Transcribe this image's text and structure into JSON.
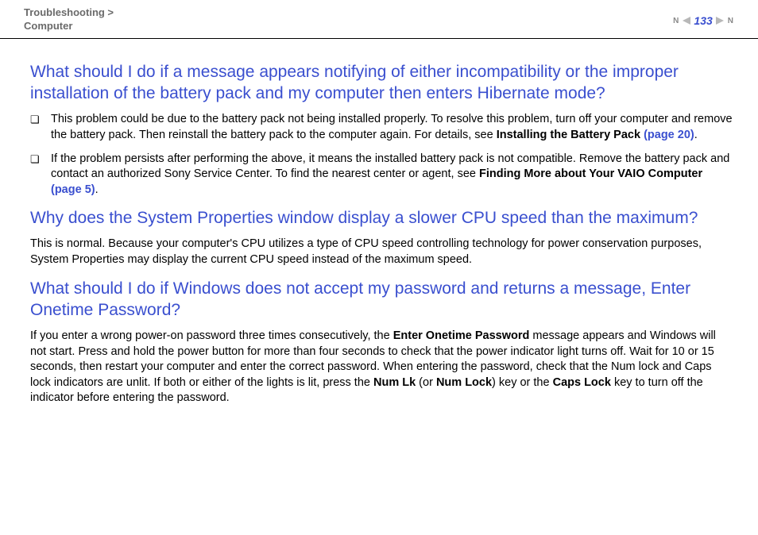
{
  "header": {
    "breadcrumb_line1": "Troubleshooting >",
    "breadcrumb_line2": "Computer",
    "page_number": "133"
  },
  "sections": [
    {
      "heading": "What should I do if a message appears notifying of either incompatibility or the improper installation of the battery pack and my computer then enters Hibernate mode?",
      "bullets": [
        {
          "text_before": "This problem could be due to the battery pack not being installed properly. To resolve this problem, turn off your computer and remove the battery pack. Then reinstall the battery pack to the computer again. For details, see ",
          "bold_ref": "Installing the Battery Pack",
          "page_ref": "(page 20)",
          "text_after": "."
        },
        {
          "text_before": "If the problem persists after performing the above, it means the installed battery pack is not compatible. Remove the battery pack and contact an authorized Sony Service Center. To find the nearest center or agent, see ",
          "bold_ref": "Finding More about Your VAIO Computer",
          "page_ref": "(page 5)",
          "text_after": "."
        }
      ]
    },
    {
      "heading": "Why does the System Properties window display a slower CPU speed than the maximum?",
      "body": "This is normal. Because your computer's CPU utilizes a type of CPU speed controlling technology for power conservation purposes, System Properties may display the current CPU speed instead of the maximum speed."
    },
    {
      "heading": "What should I do if Windows does not accept my password and returns a message, Enter Onetime Password?",
      "body_parts": {
        "p1": "If you enter a wrong power-on password three times consecutively, the ",
        "b1": "Enter Onetime Password",
        "p2": " message appears and Windows will not start. Press and hold the power button for more than four seconds to check that the power indicator light turns off. Wait for 10 or 15 seconds, then restart your computer and enter the correct password. When entering the password, check that the Num lock and Caps lock indicators are unlit. If both or either of the lights is lit, press the ",
        "b2": "Num Lk",
        "p3": " (or ",
        "b3": "Num Lock",
        "p4": ") key or the ",
        "b4": "Caps Lock",
        "p5": " key to turn off the indicator before entering the password."
      }
    }
  ]
}
